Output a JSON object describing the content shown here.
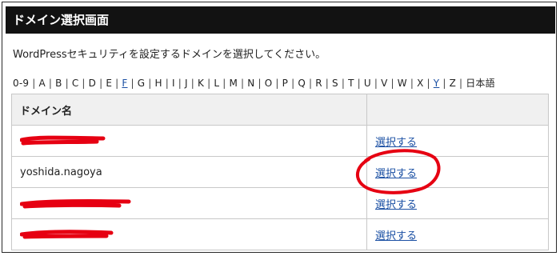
{
  "header": {
    "title": "ドメイン選択画面"
  },
  "description": "WordPressセキュリティを設定するドメインを選択してください。",
  "alpha_index": [
    {
      "label": "0-9",
      "link": false
    },
    {
      "label": "A",
      "link": false
    },
    {
      "label": "B",
      "link": false
    },
    {
      "label": "C",
      "link": false
    },
    {
      "label": "D",
      "link": false
    },
    {
      "label": "E",
      "link": false
    },
    {
      "label": "F",
      "link": true
    },
    {
      "label": "G",
      "link": false
    },
    {
      "label": "H",
      "link": false
    },
    {
      "label": "I",
      "link": false
    },
    {
      "label": "J",
      "link": false
    },
    {
      "label": "K",
      "link": false
    },
    {
      "label": "L",
      "link": false
    },
    {
      "label": "M",
      "link": false
    },
    {
      "label": "N",
      "link": false
    },
    {
      "label": "O",
      "link": false
    },
    {
      "label": "P",
      "link": false
    },
    {
      "label": "Q",
      "link": false
    },
    {
      "label": "R",
      "link": false
    },
    {
      "label": "S",
      "link": false
    },
    {
      "label": "T",
      "link": false
    },
    {
      "label": "U",
      "link": false
    },
    {
      "label": "V",
      "link": false
    },
    {
      "label": "W",
      "link": false
    },
    {
      "label": "X",
      "link": false
    },
    {
      "label": "Y",
      "link": true
    },
    {
      "label": "Z",
      "link": false
    },
    {
      "label": "日本語",
      "link": false
    }
  ],
  "table": {
    "columns": [
      "ドメイン名",
      ""
    ],
    "rows": [
      {
        "domain": "",
        "redacted": true,
        "action": "選択する"
      },
      {
        "domain": "yoshida.nagoya",
        "redacted": false,
        "action": "選択する",
        "highlighted": true
      },
      {
        "domain": "",
        "redacted": true,
        "action": "選択する"
      },
      {
        "domain": "",
        "redacted": true,
        "action": "選択する"
      }
    ]
  },
  "annotation_color": "#e60012",
  "link_color": "#1a4fa3"
}
